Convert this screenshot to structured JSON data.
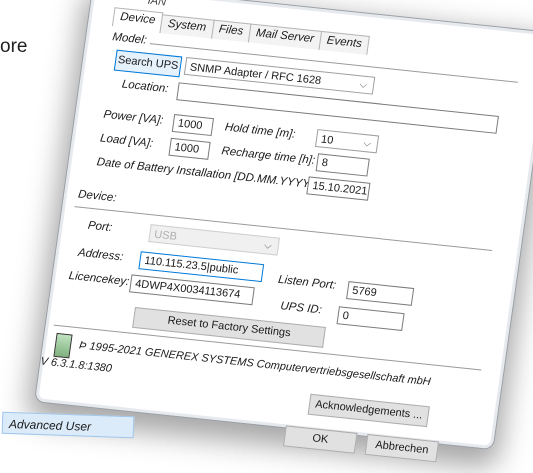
{
  "background_text": "ore",
  "dialog": {
    "title_fragment": "IAN",
    "tabs": [
      "Device",
      "System",
      "Files",
      "Mail Server",
      "Events"
    ],
    "model_section": {
      "label": "Model:",
      "search_button": "Search UPS",
      "model_value": "SNMP Adapter / RFC 1628",
      "location_label": "Location:",
      "location_value": "",
      "power_label": "Power [VA]:",
      "power_value": "1000",
      "hold_label": "Hold time [m]:",
      "hold_value": "10",
      "load_label": "Load [VA]:",
      "load_value": "1000",
      "recharge_label": "Recharge time [h]:",
      "recharge_value": "8",
      "battery_label": "Date of Battery Installation [DD.MM.YYYY]:",
      "battery_value": "15.10.2021"
    },
    "device_section": {
      "label": "Device:",
      "port_label": "Port:",
      "port_value": "USB",
      "address_label": "Address:",
      "address_value": "110.115.23.5|public",
      "listen_label": "Listen Port:",
      "listen_value": "5769",
      "licence_label": "Licencekey:",
      "licence_value": "4DWP4X0034113674",
      "upsid_label": "UPS ID:",
      "upsid_value": "0",
      "reset_button": "Reset to Factory Settings"
    },
    "footer": {
      "copyright": "Þ 1995-2021 GENEREX SYSTEMS Computervertriebsgesellschaft mbH",
      "version": "V 6.3.1.8:1380",
      "ack_button": "Acknowledgements ...",
      "ok_button": "OK",
      "cancel_button": "Abbrechen"
    }
  },
  "user_mode": "Advanced User",
  "colors": {
    "focus": "#0078d7",
    "button": "#e1e1e1"
  }
}
